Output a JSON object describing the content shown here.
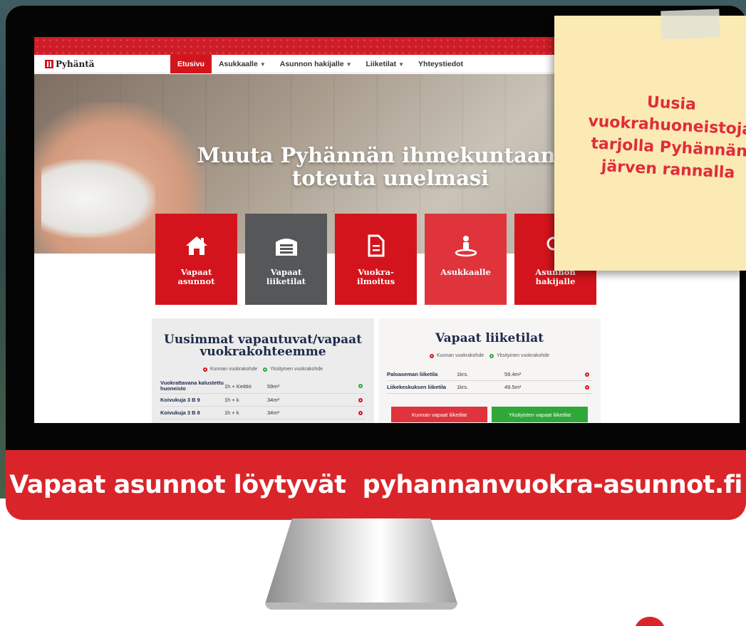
{
  "site": {
    "logo": "Pyhäntä",
    "nav": [
      {
        "label": "Etusivu",
        "active": true,
        "dropdown": false
      },
      {
        "label": "Asukkaalle",
        "active": false,
        "dropdown": true
      },
      {
        "label": "Asunnon hakijalle",
        "active": false,
        "dropdown": true
      },
      {
        "label": "Liiketilat",
        "active": false,
        "dropdown": true
      },
      {
        "label": "Yhteystiedot",
        "active": false,
        "dropdown": false
      }
    ],
    "hero_title": "Muuta Pyhännän ihmekuntaan ja toteuta unelmasi",
    "tiles": [
      {
        "label": "Vapaat\nasunnot",
        "icon": "home-icon"
      },
      {
        "label": "Vapaat\nliiketilat",
        "icon": "garage-icon"
      },
      {
        "label": "Vuokra-\nilmoitus",
        "icon": "document-icon"
      },
      {
        "label": "Asukkaalle",
        "icon": "person-location-icon"
      },
      {
        "label": "Asunnon\nhakijalle",
        "icon": "search-icon"
      }
    ],
    "left_panel": {
      "title": "Uusimmat vapautuvat/vapaat vuokrakohteemme",
      "legend_municipal": "Kunnan vuokrakohde",
      "legend_private": "Yksityinen vuokrakohde",
      "rows": [
        {
          "name": "Vuokrattavana kalustettu huoneisto",
          "rooms": "1h + Keittiö",
          "size": "59m²",
          "status": "green"
        },
        {
          "name": "Koivukuja 3 B 9",
          "rooms": "1h + k",
          "size": "34m²",
          "status": "red"
        },
        {
          "name": "Koivukuja 3 B 8",
          "rooms": "1h + k",
          "size": "34m²",
          "status": "red"
        }
      ]
    },
    "right_panel": {
      "title": "Vapaat liiketilat",
      "legend_municipal": "Kunnan vuokrakohde",
      "legend_private": "Yksityinen vuokrakohde",
      "rows": [
        {
          "name": "Paloaseman liiketila",
          "floor": "1krs.",
          "size": "59.4m²",
          "status": "red"
        },
        {
          "name": "Liikekeskuksen liiketila",
          "floor": "1krs.",
          "size": "49.5m²",
          "status": "red"
        }
      ],
      "button_municipal": "Kunnan vapaat liiketilat",
      "button_private": "Yksityisten vapaat liiketilat"
    }
  },
  "sticky_note": "Uusia\nvuokrahuoneistoja\ntarjolla Pyhännän\njärven rannalla",
  "banner": "Vapaat asunnot löytyvät  pyhannanvuokra-asunnot.fi",
  "colors": {
    "brand_red": "#d4141c",
    "banner_red": "#d9252a",
    "green": "#2fa83a",
    "navy": "#1d2a4a",
    "note_yellow": "#fbeab4"
  }
}
